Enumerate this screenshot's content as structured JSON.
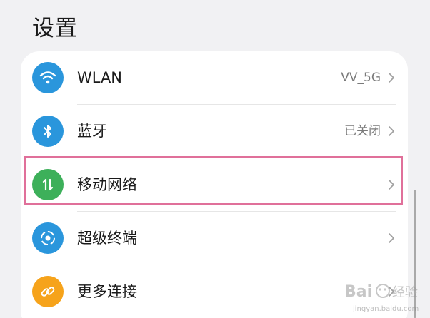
{
  "header": {
    "title": "设置"
  },
  "settings": {
    "items": [
      {
        "label": "WLAN",
        "value": "VV_5G",
        "icon": "wifi-icon",
        "icon_color": "#2a96dc"
      },
      {
        "label": "蓝牙",
        "value": "已关闭",
        "icon": "bluetooth-icon",
        "icon_color": "#2a96dc"
      },
      {
        "label": "移动网络",
        "value": "",
        "icon": "mobile-data-icon",
        "icon_color": "#3db05a"
      },
      {
        "label": "超级终端",
        "value": "",
        "icon": "super-device-icon",
        "icon_color": "#2a96dc"
      },
      {
        "label": "更多连接",
        "value": "",
        "icon": "link-icon",
        "icon_color": "#f6a31b"
      }
    ]
  },
  "annotation": {
    "highlight_color": "#e0709a"
  },
  "watermark": {
    "brand": "Baidu 经验",
    "url": "jingyan.baidu.com"
  }
}
